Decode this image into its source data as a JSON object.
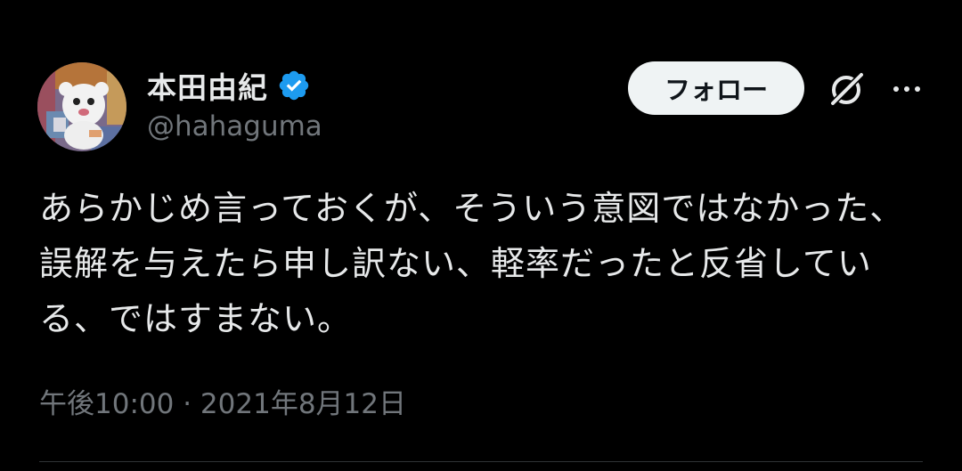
{
  "author": {
    "display_name": "本田由紀",
    "handle": "@hahaguma",
    "verified": true
  },
  "actions": {
    "follow_label": "フォロー"
  },
  "tweet": {
    "text": "あらかじめ言っておくが、そういう意図ではなかった、誤解を与えたら申し訳ない、軽率だったと反省している、ではすまない。",
    "time": "午後10:00",
    "separator": "·",
    "date": "2021年8月12日"
  },
  "icons": {
    "verified": "verified-badge-icon",
    "grok": "grok-icon",
    "more": "more-options-icon"
  },
  "colors": {
    "background": "#000000",
    "text_primary": "#e7e9ea",
    "text_secondary": "#71767b",
    "verified_blue": "#1d9bf0",
    "follow_button_bg": "#eff3f4",
    "follow_button_text": "#0f1419",
    "divider": "#2f3336"
  }
}
